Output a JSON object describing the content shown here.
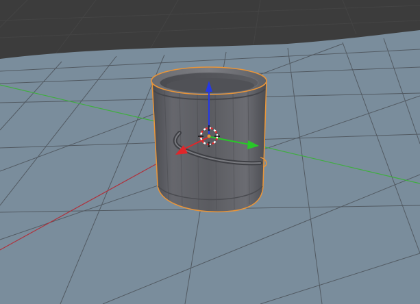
{
  "viewport": {
    "mode": "3d-view",
    "background_color": "#3c3c3c",
    "floor_color": "#7a8d9c",
    "grid_line_color": "#525a62",
    "x_axis_color": "#b0303a",
    "y_axis_color": "#3fae3f"
  },
  "object": {
    "icon": "paint-bucket-mesh",
    "selected": true,
    "outline_color": "#e8953a",
    "body_color": "#5c5d62"
  },
  "manipulator": {
    "icon": "transform-gizmo",
    "x_arrow_color": "#e0262a",
    "y_arrow_color": "#28c828",
    "z_arrow_color": "#2438e8"
  },
  "cursor_3d": {
    "icon": "3d-cursor-icon"
  }
}
